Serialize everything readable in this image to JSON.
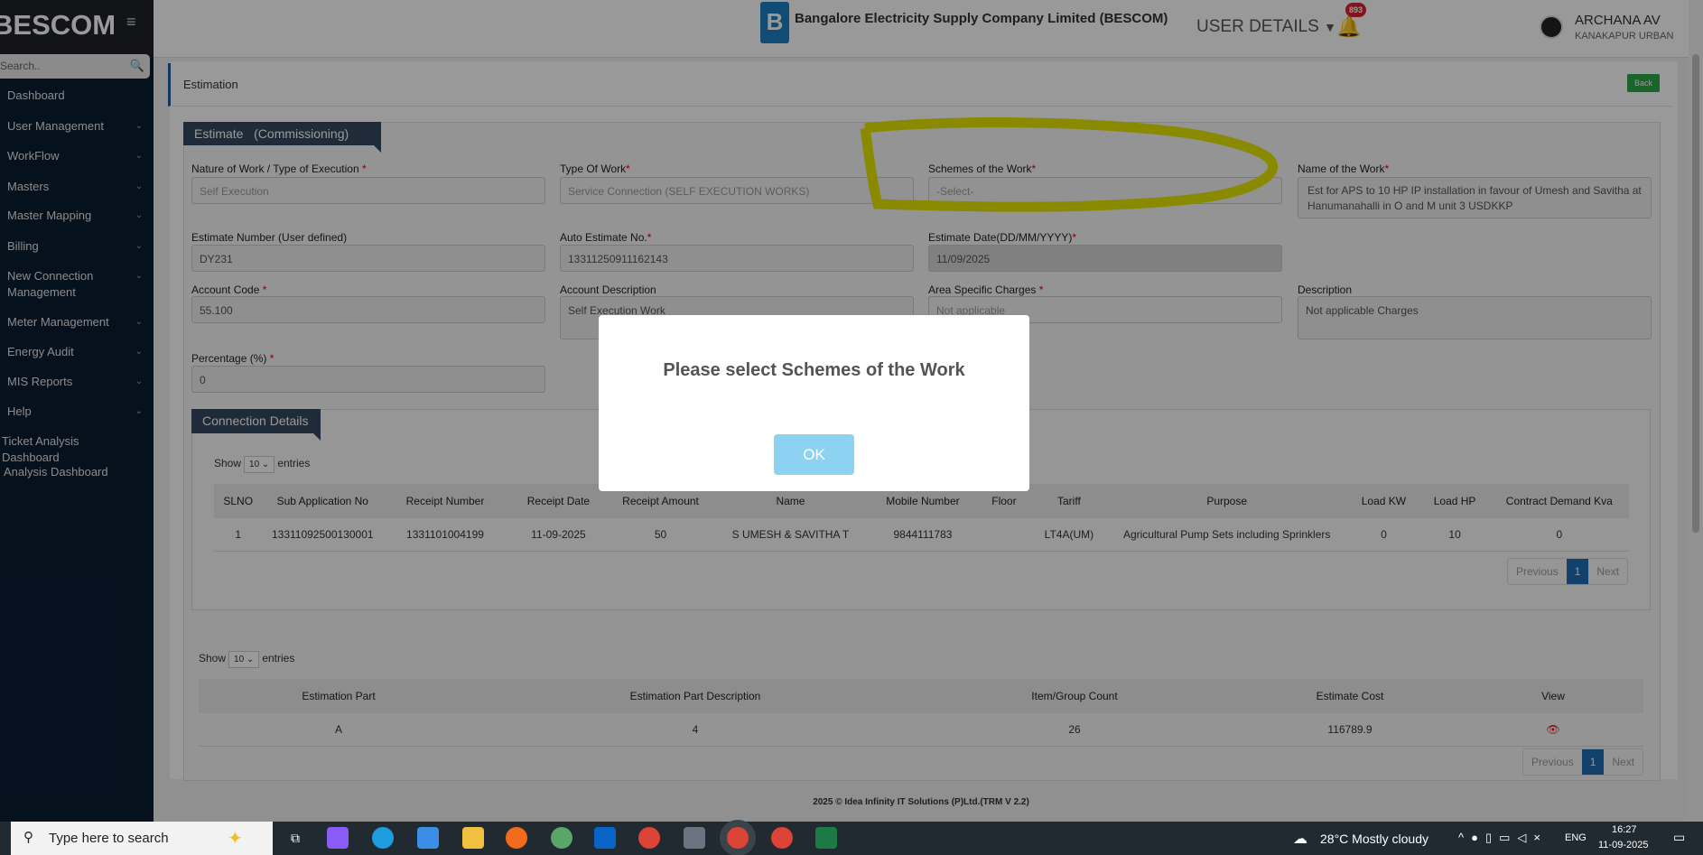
{
  "sidebar": {
    "logo": "BESCOM",
    "search_placeholder": "Search..",
    "items": [
      {
        "label": "Dashboard",
        "chev": false
      },
      {
        "label": "User Management",
        "chev": true
      },
      {
        "label": "WorkFlow",
        "chev": true
      },
      {
        "label": "Masters",
        "chev": true
      },
      {
        "label": "Master Mapping",
        "chev": true
      },
      {
        "label": "Billing",
        "chev": true
      },
      {
        "label": "New Connection Management",
        "chev": true
      },
      {
        "label": "Meter Management",
        "chev": true
      },
      {
        "label": "Energy Audit",
        "chev": true
      },
      {
        "label": "MIS Reports",
        "chev": true
      },
      {
        "label": "Help",
        "chev": true
      },
      {
        "label": "Ticket Analysis Dashboard",
        "chev": false
      },
      {
        "label": "Analysis Dashboard",
        "chev": false
      }
    ]
  },
  "header": {
    "company": "Bangalore Electricity Supply Company Limited (BESCOM)",
    "user_details": "USER DETAILS",
    "notif_count": "893",
    "user_name": "ARCHANA AV",
    "user_location": "KANAKAPUR URBAN"
  },
  "page": {
    "title": "Estimation",
    "back": "Back"
  },
  "estimate": {
    "tab": "Estimate   (Commissioning)",
    "fields": [
      {
        "label": "Nature of Work / Type of Execution",
        "req": " *",
        "value": "Self Execution"
      },
      {
        "label": "Type Of Work",
        "req": "*",
        "value": "Service Connection (SELF EXECUTION WORKS)"
      },
      {
        "label": "Schemes of the Work",
        "req": "*",
        "value": "-Select-"
      },
      {
        "label": "Name of the Work",
        "req": "*",
        "value": "Est for APS to 10 HP IP installation in favour of Umesh and Savitha at Hanumanahalli in O and M unit 3 USDKKP"
      },
      {
        "label": "Estimate Number (User defined)",
        "req": "",
        "value": "DY231"
      },
      {
        "label": "Auto Estimate No.",
        "req": "*",
        "value": "13311250911162143"
      },
      {
        "label": "Estimate Date(DD/MM/YYYY)",
        "req": "*",
        "value": "11/09/2025"
      },
      {
        "label": "Account Code",
        "req": " *",
        "value": "55.100"
      },
      {
        "label": "Account Description",
        "req": "",
        "value": "Self Execution Work"
      },
      {
        "label": "Area Specific Charges",
        "req": " *",
        "value": "Not applicable"
      },
      {
        "label": "Description",
        "req": "",
        "value": "Not applicable Charges"
      },
      {
        "label": "Percentage (%)",
        "req": " *",
        "value": "0"
      }
    ]
  },
  "connection": {
    "tab": "Connection Details",
    "show": "Show",
    "entries": "entries",
    "page_size": "10",
    "headers": [
      "SLNO",
      "Sub Application No",
      "Receipt Number",
      "Receipt Date",
      "Receipt Amount",
      "Name",
      "Mobile Number",
      "Floor",
      "Tariff",
      "Purpose",
      "Load KW",
      "Load HP",
      "Contract Demand Kva"
    ],
    "rows": [
      [
        "1",
        "13311092500130001",
        "1331101004199",
        "11-09-2025",
        "50",
        "S UMESH & SAVITHA T",
        "9844111783",
        "",
        "LT4A(UM)",
        "Agricultural Pump Sets including Sprinklers",
        "0",
        "10",
        "0"
      ]
    ],
    "pager": {
      "prev": "Previous",
      "page": "1",
      "next": "Next"
    }
  },
  "parts": {
    "show": "Show",
    "entries": "entries",
    "page_size": "10",
    "headers": [
      "Estimation Part",
      "Estimation Part Description",
      "Item/Group Count",
      "Estimate Cost",
      "View"
    ],
    "rows": [
      [
        "A",
        "4",
        "26",
        "116789.9"
      ]
    ],
    "pager": {
      "prev": "Previous",
      "page": "1",
      "next": "Next"
    }
  },
  "footer": "2025 © Idea Infinity IT Solutions (P)Ltd.(TRM V 2.2)",
  "taskbar": {
    "search": "Type here to search",
    "weather": "28°C  Mostly cloudy",
    "lang": "ENG",
    "time": "16:27",
    "date": "11-09-2025"
  },
  "modal": {
    "message": "Please select Schemes of the Work",
    "ok": "OK"
  },
  "colors": {
    "sidebar": "#0b1d33",
    "tab": "#34495e",
    "ok": "#8cd3f2",
    "highlight": "#e6e600"
  }
}
